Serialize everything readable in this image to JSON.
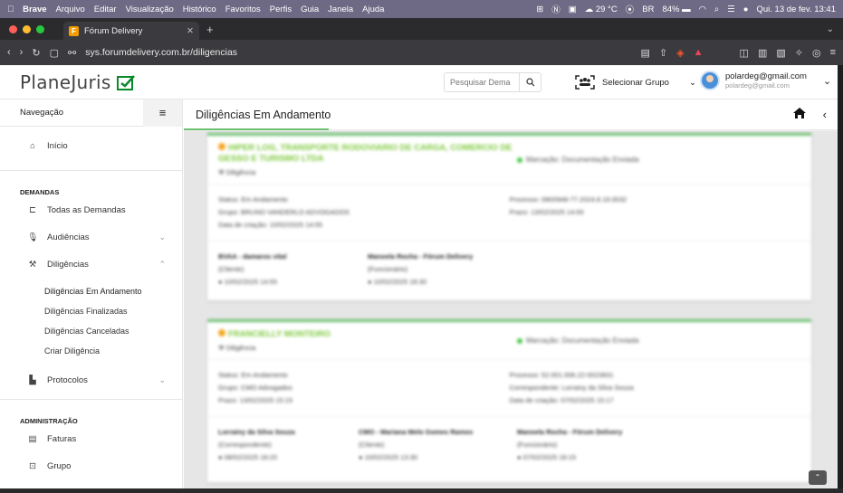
{
  "macos": {
    "menus": [
      "Brave",
      "Arquivo",
      "Editar",
      "Visualização",
      "Histórico",
      "Favoritos",
      "Perfis",
      "Guia",
      "Janela",
      "Ajuda"
    ],
    "weather": "29 °C",
    "battery": "84%",
    "datetime": "Qui. 13 de fev.  13:41"
  },
  "browser": {
    "tab_title": "Fórum Delivery",
    "url": "sys.forumdelivery.com.br/diligencias"
  },
  "header": {
    "logo_text": "PlaneJuris",
    "search_placeholder": "Pesquisar Dema",
    "group_label": "Selecionar Grupo",
    "user_email": "polardeg@gmail.com",
    "user_email_sub": "polardeg@gmail.com"
  },
  "sidebar": {
    "title": "Navegação",
    "home": "Início",
    "section_demandas": "DEMANDAS",
    "todas": "Todas as Demandas",
    "audiencias": "Audiências",
    "diligencias": "Diligências",
    "sub": [
      "Diligências Em Andamento",
      "Diligências Finalizadas",
      "Diligências Canceladas",
      "Criar Diligência"
    ],
    "protocolos": "Protocolos",
    "section_admin": "ADMINISTRAÇÃO",
    "faturas": "Faturas",
    "grupo": "Grupo"
  },
  "main": {
    "title": "Diligências Em Andamento"
  },
  "cards": [
    {
      "name": "HIPER LOG, TRANSPORTE RODOVIARIO DE CARGA, COMERCIO DE GESSO E TURISMO LTDA",
      "kind": "Diligência",
      "status": "Marcação: Documentação Enviada",
      "left": [
        "Status: Em Andamento",
        "Grupo: BRUNO VANDERLO ADVOGADOS",
        "Data de criação: 10/02/2025 14:55"
      ],
      "right": [
        "Processo: 0800948-77.2024.8.19.0032",
        "Prazo: 13/02/2025 14:00"
      ],
      "people": [
        {
          "name": "BVAA - damaros vital",
          "role": "(Cliente)",
          "date": "10/02/2025 14:55"
        },
        {
          "name": "Manoela Rocha - Fórum Delivery",
          "role": "(Funcionário)",
          "date": "10/02/2025 18:30"
        }
      ]
    },
    {
      "name": "FRANCIELLY MONTEIRO",
      "kind": "Diligência",
      "status": "Marcação: Documentação Enviada",
      "left": [
        "Status: Em Andamento",
        "Grupo: CMO Advogados",
        "Prazo: 13/02/2025 15:15"
      ],
      "right": [
        "Processo: 52.001.006.22-0023831",
        "Correspondente: Lorrainy da Silva Souza",
        "Data de criação: 07/02/2025 15:17"
      ],
      "people": [
        {
          "name": "Lorrainy da Silva Souza",
          "role": "(Correspondente)",
          "date": "08/02/2025 18:20"
        },
        {
          "name": "CMO - Mariana Melo Gomes Ramos",
          "role": "(Cliente)",
          "date": "10/02/2025 13:30"
        },
        {
          "name": "Manoela Rocha - Fórum Delivery",
          "role": "(Funcionário)",
          "date": "07/02/2025 18:15"
        }
      ]
    }
  ]
}
